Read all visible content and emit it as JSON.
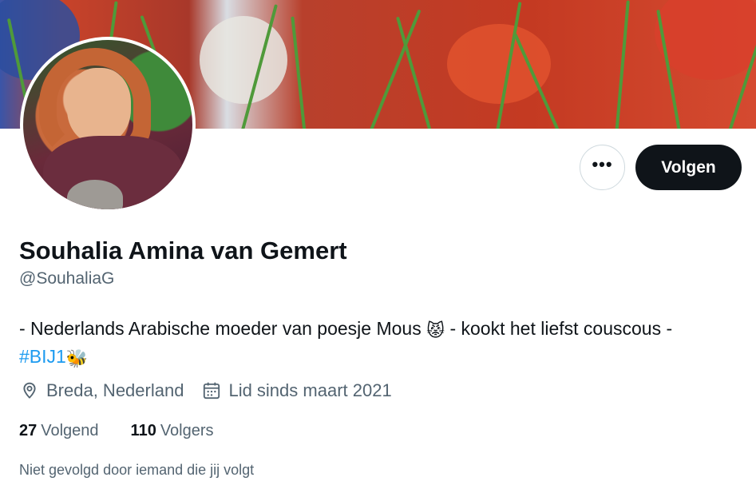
{
  "profile": {
    "display_name": "Souhalia Amina van Gemert",
    "handle": "@SouhaliaG",
    "bio_text": "- Nederlands Arabische moeder van poesje Mous",
    "bio_emoji_cat": "😾",
    "bio_text_2": "- kookt het liefst couscous -",
    "bio_hashtag": "#BIJ1",
    "bio_emoji_bee": "🐝",
    "location": "Breda, Nederland",
    "joined": "Lid sinds maart 2021",
    "following_count": "27",
    "following_label": "Volgend",
    "followers_count": "110",
    "followers_label": "Volgers",
    "follow_context": "Niet gevolgd door iemand die jij volgt"
  },
  "actions": {
    "more_label": "•••",
    "follow_label": "Volgen"
  },
  "colors": {
    "text": "#0f1419",
    "secondary": "#536471",
    "link": "#1d9bf0",
    "button_dark": "#0f1419"
  },
  "icons": {
    "location": "location-pin-icon",
    "calendar": "calendar-icon"
  }
}
